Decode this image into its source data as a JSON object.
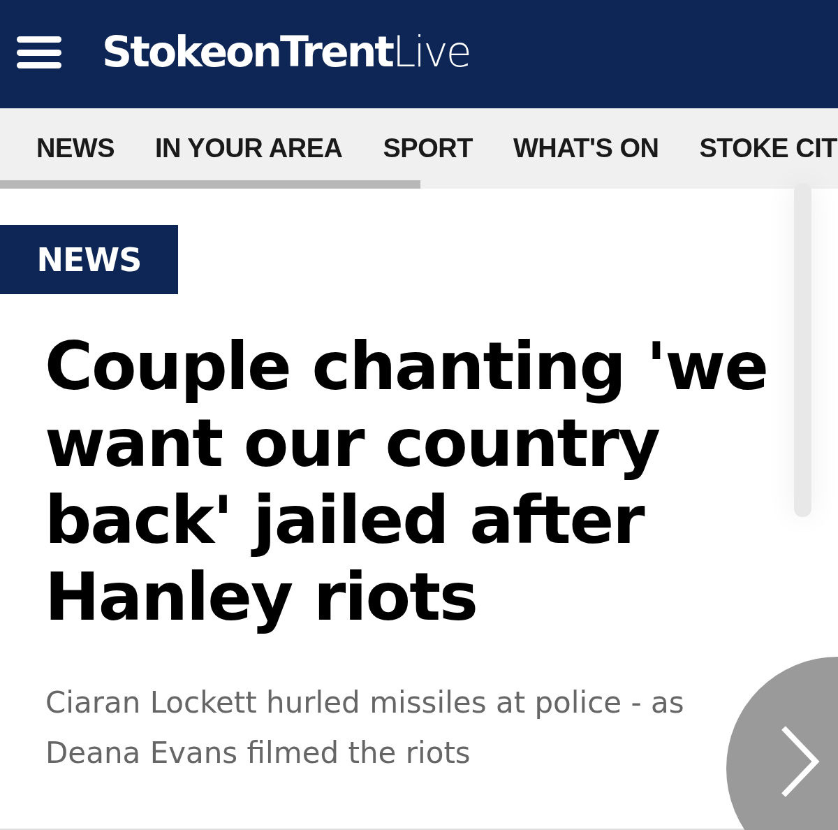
{
  "header": {
    "logo": "**StokeonTrent**Live"
  },
  "nav": {
    "tabs": [
      {
        "label": "NEWS"
      },
      {
        "label": "IN YOUR AREA"
      },
      {
        "label": "SPORT"
      },
      {
        "label": "WHAT'S ON"
      },
      {
        "label": "STOKE CIT"
      }
    ]
  },
  "article": {
    "section": "NEWS",
    "headline": "Couple chanting 'we want our country back' jailed after Hanley riots",
    "standfirst": "Ciaran Lockett hurled missiles at police - as Deana Evans filmed the riots"
  }
}
